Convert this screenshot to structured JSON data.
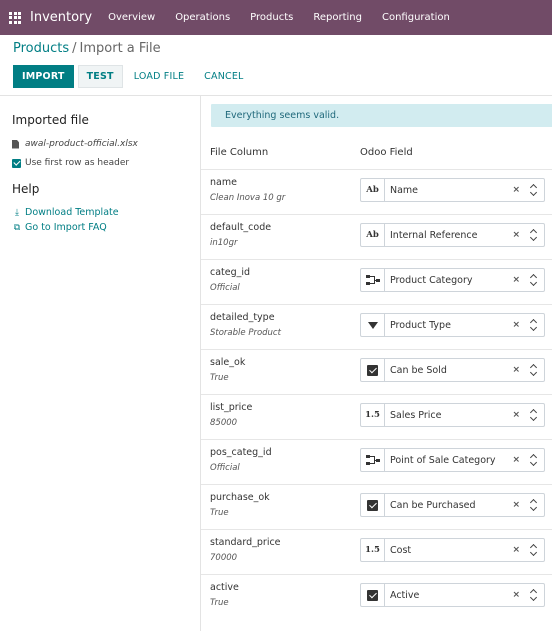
{
  "topbar": {
    "app_name": "Inventory",
    "menu": [
      "Overview",
      "Operations",
      "Products",
      "Reporting",
      "Configuration"
    ]
  },
  "breadcrumb": {
    "parent": "Products",
    "separator": "/",
    "current": "Import a File"
  },
  "toolbar": {
    "import": "IMPORT",
    "test": "TEST",
    "load_file": "LOAD FILE",
    "cancel": "CANCEL"
  },
  "sidebar": {
    "imported_title": "Imported file",
    "file_name": "awal-product-official.xlsx",
    "header_option": "Use first row as header",
    "header_checked": true,
    "help_title": "Help",
    "download_template": "Download Template",
    "import_faq": "Go to Import FAQ"
  },
  "alert": {
    "message": "Everything seems valid."
  },
  "table": {
    "col_file": "File Column",
    "col_odoo": "Odoo Field",
    "rows": [
      {
        "column": "name",
        "sample": "Clean Inova 10 gr",
        "field": "Name",
        "icon": "text-icon",
        "icon_text": "Ab"
      },
      {
        "column": "default_code",
        "sample": "in10gr",
        "field": "Internal Reference",
        "icon": "text-icon",
        "icon_text": "Ab"
      },
      {
        "column": "categ_id",
        "sample": "Official",
        "field": "Product Category",
        "icon": "relation-icon",
        "icon_text": ""
      },
      {
        "column": "detailed_type",
        "sample": "Storable Product",
        "field": "Product Type",
        "icon": "selection-icon",
        "icon_text": ""
      },
      {
        "column": "sale_ok",
        "sample": "True",
        "field": "Can be Sold",
        "icon": "checkbox-icon",
        "icon_text": ""
      },
      {
        "column": "list_price",
        "sample": "85000",
        "field": "Sales Price",
        "icon": "number-icon",
        "icon_text": "1.5"
      },
      {
        "column": "pos_categ_id",
        "sample": "Official",
        "field": "Point of Sale Category",
        "icon": "relation-icon",
        "icon_text": ""
      },
      {
        "column": "purchase_ok",
        "sample": "True",
        "field": "Can be Purchased",
        "icon": "checkbox-icon",
        "icon_text": ""
      },
      {
        "column": "standard_price",
        "sample": "70000",
        "field": "Cost",
        "icon": "number-icon",
        "icon_text": "1.5"
      },
      {
        "column": "active",
        "sample": "True",
        "field": "Active",
        "icon": "checkbox-icon",
        "icon_text": ""
      }
    ]
  },
  "colors": {
    "brand": "#714b67",
    "accent": "#017e84",
    "alert_bg": "#d2ecf0"
  }
}
